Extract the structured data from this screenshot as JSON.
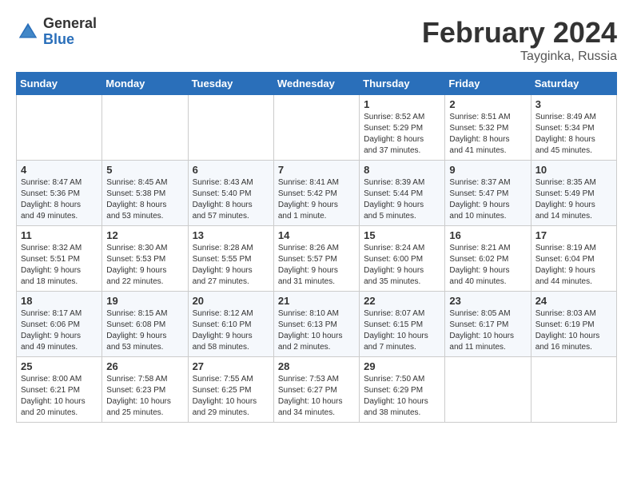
{
  "header": {
    "logo_general": "General",
    "logo_blue": "Blue",
    "title": "February 2024",
    "subtitle": "Tayginka, Russia"
  },
  "weekdays": [
    "Sunday",
    "Monday",
    "Tuesday",
    "Wednesday",
    "Thursday",
    "Friday",
    "Saturday"
  ],
  "weeks": [
    [
      {
        "day": "",
        "info": ""
      },
      {
        "day": "",
        "info": ""
      },
      {
        "day": "",
        "info": ""
      },
      {
        "day": "",
        "info": ""
      },
      {
        "day": "1",
        "info": "Sunrise: 8:52 AM\nSunset: 5:29 PM\nDaylight: 8 hours\nand 37 minutes."
      },
      {
        "day": "2",
        "info": "Sunrise: 8:51 AM\nSunset: 5:32 PM\nDaylight: 8 hours\nand 41 minutes."
      },
      {
        "day": "3",
        "info": "Sunrise: 8:49 AM\nSunset: 5:34 PM\nDaylight: 8 hours\nand 45 minutes."
      }
    ],
    [
      {
        "day": "4",
        "info": "Sunrise: 8:47 AM\nSunset: 5:36 PM\nDaylight: 8 hours\nand 49 minutes."
      },
      {
        "day": "5",
        "info": "Sunrise: 8:45 AM\nSunset: 5:38 PM\nDaylight: 8 hours\nand 53 minutes."
      },
      {
        "day": "6",
        "info": "Sunrise: 8:43 AM\nSunset: 5:40 PM\nDaylight: 8 hours\nand 57 minutes."
      },
      {
        "day": "7",
        "info": "Sunrise: 8:41 AM\nSunset: 5:42 PM\nDaylight: 9 hours\nand 1 minute."
      },
      {
        "day": "8",
        "info": "Sunrise: 8:39 AM\nSunset: 5:44 PM\nDaylight: 9 hours\nand 5 minutes."
      },
      {
        "day": "9",
        "info": "Sunrise: 8:37 AM\nSunset: 5:47 PM\nDaylight: 9 hours\nand 10 minutes."
      },
      {
        "day": "10",
        "info": "Sunrise: 8:35 AM\nSunset: 5:49 PM\nDaylight: 9 hours\nand 14 minutes."
      }
    ],
    [
      {
        "day": "11",
        "info": "Sunrise: 8:32 AM\nSunset: 5:51 PM\nDaylight: 9 hours\nand 18 minutes."
      },
      {
        "day": "12",
        "info": "Sunrise: 8:30 AM\nSunset: 5:53 PM\nDaylight: 9 hours\nand 22 minutes."
      },
      {
        "day": "13",
        "info": "Sunrise: 8:28 AM\nSunset: 5:55 PM\nDaylight: 9 hours\nand 27 minutes."
      },
      {
        "day": "14",
        "info": "Sunrise: 8:26 AM\nSunset: 5:57 PM\nDaylight: 9 hours\nand 31 minutes."
      },
      {
        "day": "15",
        "info": "Sunrise: 8:24 AM\nSunset: 6:00 PM\nDaylight: 9 hours\nand 35 minutes."
      },
      {
        "day": "16",
        "info": "Sunrise: 8:21 AM\nSunset: 6:02 PM\nDaylight: 9 hours\nand 40 minutes."
      },
      {
        "day": "17",
        "info": "Sunrise: 8:19 AM\nSunset: 6:04 PM\nDaylight: 9 hours\nand 44 minutes."
      }
    ],
    [
      {
        "day": "18",
        "info": "Sunrise: 8:17 AM\nSunset: 6:06 PM\nDaylight: 9 hours\nand 49 minutes."
      },
      {
        "day": "19",
        "info": "Sunrise: 8:15 AM\nSunset: 6:08 PM\nDaylight: 9 hours\nand 53 minutes."
      },
      {
        "day": "20",
        "info": "Sunrise: 8:12 AM\nSunset: 6:10 PM\nDaylight: 9 hours\nand 58 minutes."
      },
      {
        "day": "21",
        "info": "Sunrise: 8:10 AM\nSunset: 6:13 PM\nDaylight: 10 hours\nand 2 minutes."
      },
      {
        "day": "22",
        "info": "Sunrise: 8:07 AM\nSunset: 6:15 PM\nDaylight: 10 hours\nand 7 minutes."
      },
      {
        "day": "23",
        "info": "Sunrise: 8:05 AM\nSunset: 6:17 PM\nDaylight: 10 hours\nand 11 minutes."
      },
      {
        "day": "24",
        "info": "Sunrise: 8:03 AM\nSunset: 6:19 PM\nDaylight: 10 hours\nand 16 minutes."
      }
    ],
    [
      {
        "day": "25",
        "info": "Sunrise: 8:00 AM\nSunset: 6:21 PM\nDaylight: 10 hours\nand 20 minutes."
      },
      {
        "day": "26",
        "info": "Sunrise: 7:58 AM\nSunset: 6:23 PM\nDaylight: 10 hours\nand 25 minutes."
      },
      {
        "day": "27",
        "info": "Sunrise: 7:55 AM\nSunset: 6:25 PM\nDaylight: 10 hours\nand 29 minutes."
      },
      {
        "day": "28",
        "info": "Sunrise: 7:53 AM\nSunset: 6:27 PM\nDaylight: 10 hours\nand 34 minutes."
      },
      {
        "day": "29",
        "info": "Sunrise: 7:50 AM\nSunset: 6:29 PM\nDaylight: 10 hours\nand 38 minutes."
      },
      {
        "day": "",
        "info": ""
      },
      {
        "day": "",
        "info": ""
      }
    ]
  ]
}
